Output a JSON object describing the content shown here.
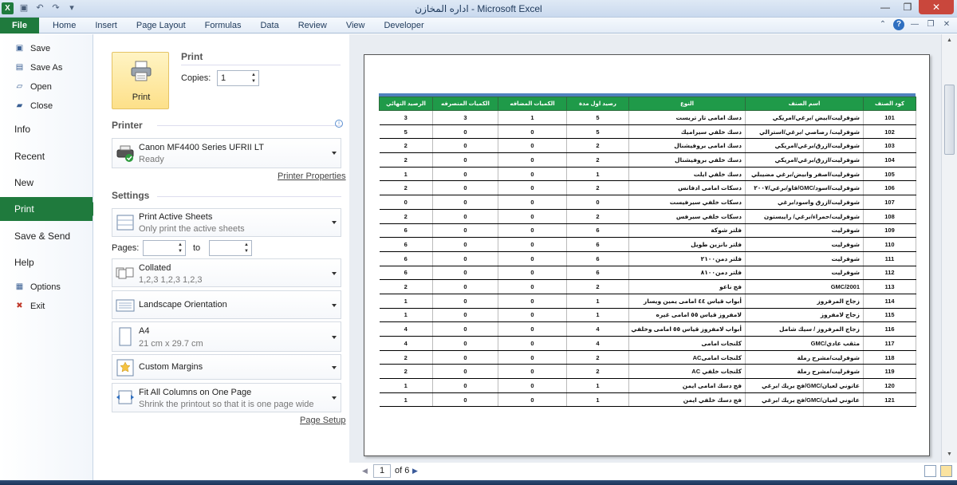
{
  "window": {
    "title": "اداره المخازن  -  Microsoft Excel",
    "app_badge": "X",
    "qat": [
      "save-icon",
      "undo-icon",
      "redo-icon",
      "customize-icon"
    ]
  },
  "ribbon": {
    "file_tab": "File",
    "tabs": [
      "Home",
      "Insert",
      "Page Layout",
      "Formulas",
      "Data",
      "Review",
      "View",
      "Developer"
    ],
    "help_icon": "?"
  },
  "backstage": {
    "items_small": [
      {
        "label": "Save",
        "icon": "save-icon"
      },
      {
        "label": "Save As",
        "icon": "save-as-icon"
      },
      {
        "label": "Open",
        "icon": "open-folder-icon"
      },
      {
        "label": "Close",
        "icon": "close-folder-icon"
      }
    ],
    "items_big": [
      "Info",
      "Recent",
      "New",
      "Print",
      "Save & Send",
      "Help"
    ],
    "active": "Print",
    "items_bottom": [
      {
        "label": "Options",
        "icon": "options-icon"
      },
      {
        "label": "Exit",
        "icon": "exit-icon"
      }
    ]
  },
  "print_panel": {
    "button_label": "Print",
    "heading": "Print",
    "copies_label": "Copies:",
    "copies_value": "1",
    "printer_heading": "Printer",
    "printer_name": "Canon MF4400 Series UFRII LT",
    "printer_status": "Ready",
    "printer_properties": "Printer Properties",
    "settings_heading": "Settings",
    "print_what": {
      "title": "Print Active Sheets",
      "subtitle": "Only print the active sheets"
    },
    "pages_label": "Pages:",
    "to_label": "to",
    "collation": {
      "title": "Collated",
      "subtitle": "1,2,3    1,2,3    1,2,3"
    },
    "orientation": {
      "title": "Landscape Orientation"
    },
    "paper": {
      "title": "A4",
      "subtitle": "21 cm x 29.7 cm"
    },
    "margins": {
      "title": "Custom Margins"
    },
    "scaling": {
      "title": "Fit All Columns on One Page",
      "subtitle": "Shrink the printout so that it is one page wide"
    },
    "page_setup": "Page Setup"
  },
  "sheet": {
    "headers": [
      "الرصيد النهائي",
      "الكميات المنصرفه",
      "الكميات المضافه",
      "رصيد اول مدة",
      "النوع",
      "اسم الصنف",
      "كود الصنف"
    ],
    "rows": [
      [
        "3",
        "3",
        "1",
        "5",
        "دسك امامى تار تريست",
        "شوفرليت/ابيض /برغي/امريكي",
        "101"
      ],
      [
        "5",
        "0",
        "0",
        "5",
        "دسك خلفي سيراميك",
        "شوفرليت/ رصاصي /برغي/استرالي",
        "102"
      ],
      [
        "2",
        "0",
        "0",
        "2",
        "دسك امامى بروفيشنال",
        "شوفرليت/ازرق/برغي/امريكي",
        "103"
      ],
      [
        "2",
        "0",
        "0",
        "2",
        "دسك خلفي بروفيشنال",
        "شوفرليت/ازرق/برغي/امريكي",
        "104"
      ],
      [
        "1",
        "0",
        "0",
        "1",
        "دسك خلفي ايلت",
        "شوفرليت/اصفر وابيض/برغي مضيبلي",
        "105"
      ],
      [
        "2",
        "0",
        "0",
        "2",
        "دسكات امامى ادفانس",
        "شوفرليت/اسود/GMC/قاو/برغي/٢٠٠٧",
        "106"
      ],
      [
        "0",
        "0",
        "0",
        "0",
        "دسكات خلفي سيرفيست",
        "شوفرليت/ازرق واسود/برغي",
        "107"
      ],
      [
        "2",
        "0",
        "0",
        "2",
        "دسكات خلفي سيرفس",
        "شوفرليت/حمراء/برغي/ رايبستون",
        "108"
      ],
      [
        "6",
        "0",
        "0",
        "6",
        "فلتر شوكة",
        "شوفرليت",
        "109"
      ],
      [
        "6",
        "0",
        "0",
        "6",
        "فلتر بانزين طويل",
        "شوفرليت",
        "110"
      ],
      [
        "6",
        "0",
        "0",
        "6",
        "فلتر دمن٢١٠٠",
        "شوفرليت",
        "111"
      ],
      [
        "6",
        "0",
        "0",
        "6",
        "فلتر دمن٨١٠٠",
        "شوفرليت",
        "112"
      ],
      [
        "2",
        "0",
        "0",
        "2",
        "فج ناعو",
        "GMC/2001",
        "113"
      ],
      [
        "1",
        "0",
        "0",
        "1",
        "أبواب قياس ٤٤ امامى يمين ويسار",
        "زجاج المرفروز",
        "114"
      ],
      [
        "1",
        "0",
        "0",
        "1",
        "لامفروز قياس ٥٥ امامى غيره",
        "زجاج لامفروز",
        "115"
      ],
      [
        "4",
        "0",
        "0",
        "4",
        "أبواب لامفروز قياس ٥٥ امامى وخلفي يمين ويسار",
        "زجاج المرفروز / سيك شامل",
        "116"
      ],
      [
        "4",
        "0",
        "0",
        "4",
        "كلنجات امامى",
        "مثقب عادي/GMC",
        "117"
      ],
      [
        "2",
        "0",
        "0",
        "2",
        "كلنجات امامىAC",
        "شوفرليت/مشرح رملة",
        "118"
      ],
      [
        "2",
        "0",
        "0",
        "2",
        "كلنجات خلفي AC",
        "شوفرليت/مشرح رملة",
        "119"
      ],
      [
        "1",
        "0",
        "0",
        "1",
        "فج دسك امامى ايمن",
        "عاتوني لعيان/GMC/فج بريك /برغي",
        "120"
      ],
      [
        "1",
        "0",
        "0",
        "1",
        "فج دسك خلفي ايمن",
        "عاتوني لعيان/GMC/فج بريك /برغي",
        "121"
      ]
    ]
  },
  "pager": {
    "current_page": "1",
    "of_text": "of 6"
  }
}
